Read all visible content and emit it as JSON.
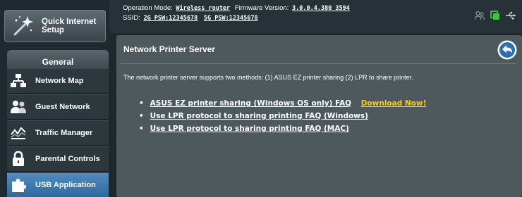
{
  "sidebar": {
    "quick_setup_label": "Quick Internet Setup",
    "section_header": "General",
    "items": [
      {
        "label": "Network Map"
      },
      {
        "label": "Guest Network"
      },
      {
        "label": "Traffic Manager"
      },
      {
        "label": "Parental Controls"
      },
      {
        "label": "USB Application",
        "active": true
      }
    ]
  },
  "topbar": {
    "operation_mode_label": "Operation Mode:",
    "operation_mode_value": "Wireless router",
    "firmware_label": "Firmware Version:",
    "firmware_value": "3.0.0.4.380_3594",
    "ssid_label": "SSID:",
    "ssid_2g": "2G_PSW:12345678",
    "ssid_5g": "5G_PSW:12345678"
  },
  "panel": {
    "title": "Network Printer Server",
    "intro": "The network printer server supports two methods: (1) ASUS EZ printer sharing (2) LPR to share printer.",
    "links": [
      {
        "label": "ASUS EZ printer sharing (Windows OS only) FAQ",
        "extra": "Download Now!"
      },
      {
        "label": "Use LPR protocol to sharing printing FAQ (Windows)"
      },
      {
        "label": "Use LPR protocol to sharing printing FAQ (MAC)"
      }
    ]
  },
  "colors": {
    "accent_blue": "#2e6a9e",
    "download_link": "#ffcc00",
    "usb_icon_green": "#33cc33"
  }
}
